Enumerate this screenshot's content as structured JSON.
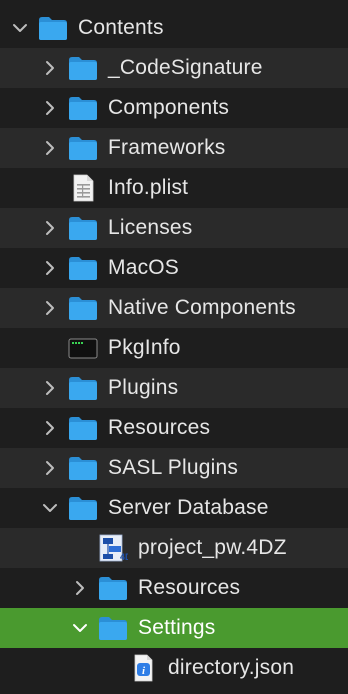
{
  "tree": {
    "rows": [
      {
        "label": "Contents",
        "icon": "folder-icon",
        "chevron": "down"
      },
      {
        "label": "_CodeSignature",
        "icon": "folder-icon",
        "chevron": "right"
      },
      {
        "label": "Components",
        "icon": "folder-icon",
        "chevron": "right"
      },
      {
        "label": "Frameworks",
        "icon": "folder-icon",
        "chevron": "right"
      },
      {
        "label": "Info.plist",
        "icon": "plist-file-icon",
        "chevron": "none"
      },
      {
        "label": "Licenses",
        "icon": "folder-icon",
        "chevron": "right"
      },
      {
        "label": "MacOS",
        "icon": "folder-icon",
        "chevron": "right"
      },
      {
        "label": "Native Components",
        "icon": "folder-icon",
        "chevron": "right"
      },
      {
        "label": "PkgInfo",
        "icon": "executable-file-icon",
        "chevron": "none"
      },
      {
        "label": "Plugins",
        "icon": "folder-icon",
        "chevron": "right"
      },
      {
        "label": "Resources",
        "icon": "folder-icon",
        "chevron": "right"
      },
      {
        "label": "SASL Plugins",
        "icon": "folder-icon",
        "chevron": "right"
      },
      {
        "label": "Server Database",
        "icon": "folder-icon",
        "chevron": "down"
      },
      {
        "label": "project_pw.4DZ",
        "icon": "4d-database-file-icon",
        "chevron": "none"
      },
      {
        "label": "Resources",
        "icon": "folder-icon",
        "chevron": "right"
      },
      {
        "label": "Settings",
        "icon": "folder-icon",
        "chevron": "down",
        "selected": true
      },
      {
        "label": "directory.json",
        "icon": "json-file-icon",
        "chevron": "none"
      }
    ]
  },
  "colors": {
    "background": "#1e1e1e",
    "row_alt": "#2a2a2a",
    "selection": "#4a9a2f",
    "folder": "#3aa8ef",
    "text": "#e6e6e6"
  }
}
